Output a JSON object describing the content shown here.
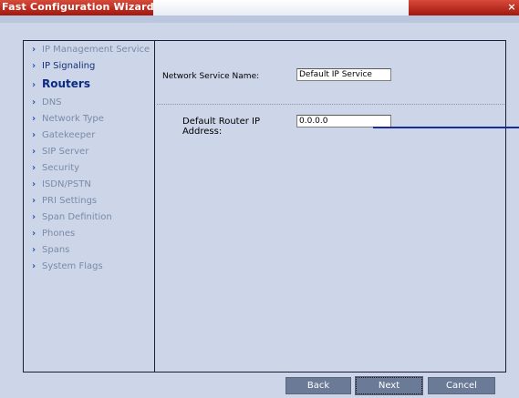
{
  "window": {
    "title": "Fast Configuration Wizard",
    "close_glyph": "×"
  },
  "sidebar": {
    "items": [
      {
        "label": "IP Management Service",
        "state": "inactive"
      },
      {
        "label": "IP Signaling",
        "state": "active"
      },
      {
        "label": "Routers",
        "state": "current"
      },
      {
        "label": "DNS",
        "state": "inactive"
      },
      {
        "label": "Network Type",
        "state": "inactive"
      },
      {
        "label": "Gatekeeper",
        "state": "inactive"
      },
      {
        "label": "SIP Server",
        "state": "inactive"
      },
      {
        "label": "Security",
        "state": "inactive"
      },
      {
        "label": "ISDN/PSTN",
        "state": "inactive"
      },
      {
        "label": "PRI Settings",
        "state": "inactive"
      },
      {
        "label": "Span Definition",
        "state": "inactive"
      },
      {
        "label": "Phones",
        "state": "inactive"
      },
      {
        "label": "Spans",
        "state": "inactive"
      },
      {
        "label": "System Flags",
        "state": "inactive"
      }
    ],
    "arrow_glyph": "›"
  },
  "form": {
    "network_service_label": "Network Service Name:",
    "network_service_value": "Default IP Service",
    "default_router_label_line1": "Default Router IP",
    "default_router_label_line2": "Address:",
    "default_router_value": "0.0.0.0"
  },
  "buttons": {
    "back": "Back",
    "next": "Next",
    "cancel": "Cancel"
  },
  "colors": {
    "title_bar": "#b52a1c",
    "panel_bg": "#ccd6e8",
    "accent_arrow": "#1f57a6",
    "button_bg": "#6b7a96"
  }
}
